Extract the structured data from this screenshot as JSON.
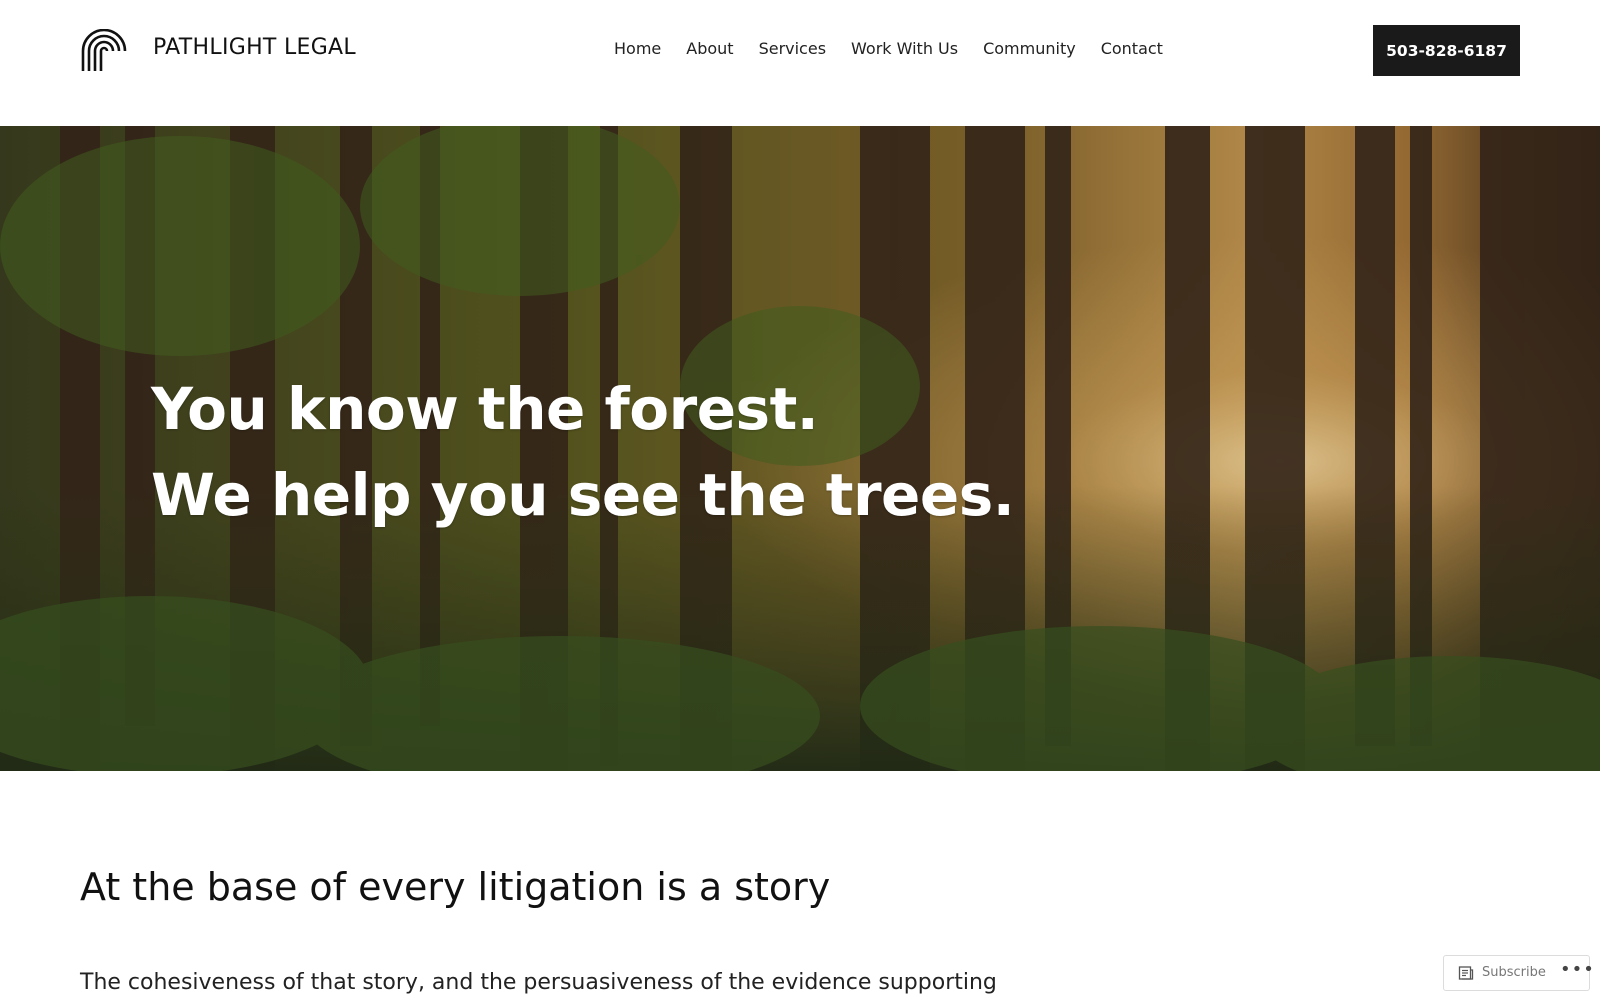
{
  "header": {
    "brand": "PATHLIGHT LEGAL",
    "logo_icon": "concentric-arch-icon",
    "nav": [
      "Home",
      "About",
      "Services",
      "Work With Us",
      "Community",
      "Contact"
    ],
    "phone": "503-828-6187"
  },
  "hero": {
    "line1": "You know the forest.",
    "line2": "We help you see the trees.",
    "image": "forest-photo"
  },
  "main": {
    "heading": "At the base of every litigation is a story",
    "paragraph": "The cohesiveness of that story, and the persuasiveness of the evidence supporting"
  },
  "subscribe": {
    "label": "Subscribe",
    "icon": "reader-icon",
    "more": "•••"
  },
  "colors": {
    "button_bg": "#1a1a1a",
    "text": "#111111",
    "hero_text": "#ffffff"
  }
}
